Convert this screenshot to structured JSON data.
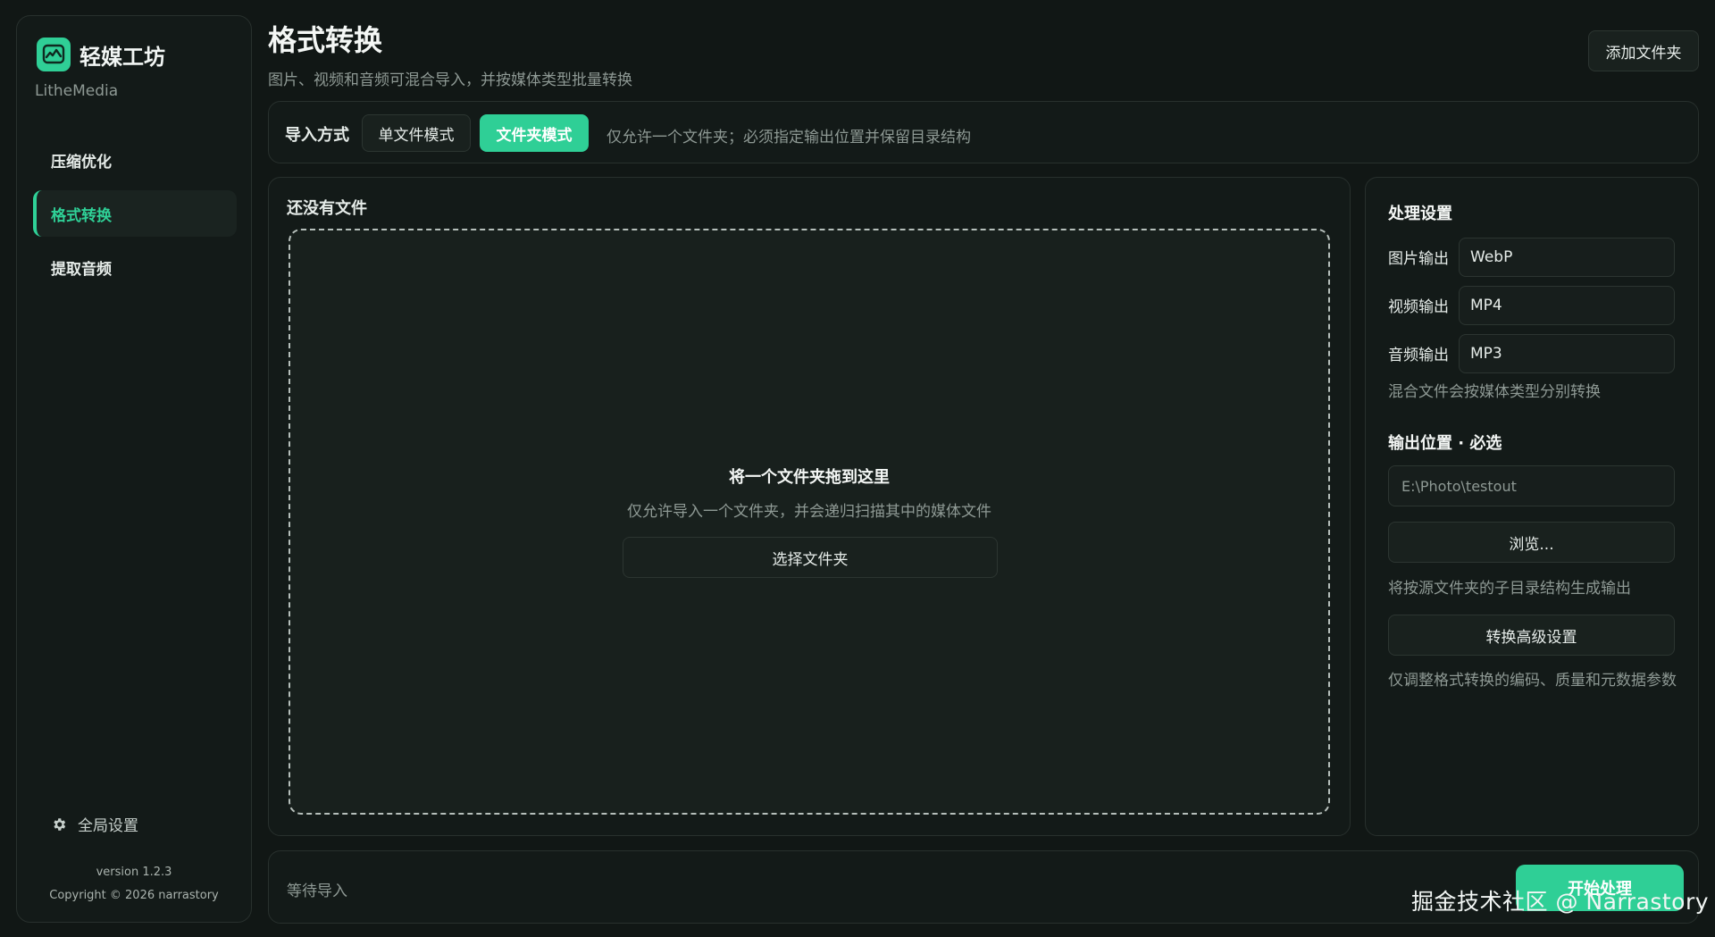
{
  "sidebar": {
    "brand_name": "轻媒工坊",
    "brand_sub": "LitheMedia",
    "nav": [
      {
        "label": "压缩优化"
      },
      {
        "label": "格式转换"
      },
      {
        "label": "提取音频"
      }
    ],
    "global_settings": "全局设置",
    "version": "version 1.2.3",
    "copyright": "Copyright © 2026 narrastory"
  },
  "header": {
    "title": "格式转换",
    "subtitle": "图片、视频和音频可混合导入，并按媒体类型批量转换",
    "add_folder": "添加文件夹"
  },
  "import_mode": {
    "label": "导入方式",
    "single": "单文件模式",
    "folder": "文件夹模式",
    "hint": "仅允许一个文件夹；必须指定输出位置并保留目录结构"
  },
  "file_panel": {
    "title": "还没有文件",
    "drop_title": "将一个文件夹拖到这里",
    "drop_hint": "仅允许导入一个文件夹，并会递归扫描其中的媒体文件",
    "choose_folder": "选择文件夹"
  },
  "settings": {
    "title": "处理设置",
    "image_label": "图片输出",
    "image_value": "WebP",
    "video_label": "视频输出",
    "video_value": "MP4",
    "audio_label": "音频输出",
    "audio_value": "MP3",
    "mixed_note": "混合文件会按媒体类型分别转换",
    "output_title": "输出位置 · 必选",
    "output_placeholder": "E:\\Photo\\testout",
    "browse": "浏览...",
    "structure_note": "将按源文件夹的子目录结构生成输出",
    "advanced": "转换高级设置",
    "advanced_note": "仅调整格式转换的编码、质量和元数据参数"
  },
  "status": {
    "text": "等待导入",
    "start": "开始处理"
  },
  "watermark": "掘金技术社区 @ Narrastory",
  "colors": {
    "accent": "#2fcf96",
    "background": "#111715",
    "panel": "#131a18"
  }
}
